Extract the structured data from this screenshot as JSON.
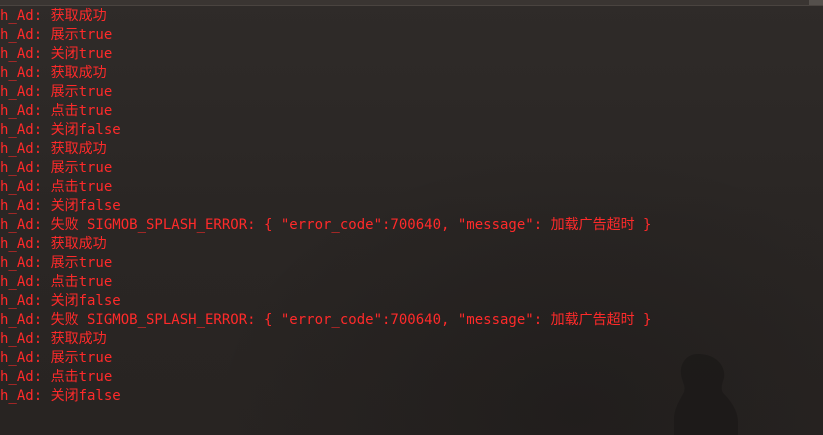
{
  "lines": [
    "h_Ad: 获取成功",
    "h_Ad: 展示true",
    "h_Ad: 关闭true",
    "h_Ad: 获取成功",
    "h_Ad: 展示true",
    "h_Ad: 点击true",
    "h_Ad: 关闭false",
    "h_Ad: 获取成功",
    "h_Ad: 展示true",
    "h_Ad: 点击true",
    "h_Ad: 关闭false",
    "h_Ad: 失败 SIGMOB_SPLASH_ERROR: { \"error_code\":700640, \"message\": 加载广告超时 }",
    "h_Ad: 获取成功",
    "h_Ad: 展示true",
    "h_Ad: 点击true",
    "h_Ad: 关闭false",
    "h_Ad: 失败 SIGMOB_SPLASH_ERROR: { \"error_code\":700640, \"message\": 加载广告超时 }",
    "h_Ad: 获取成功",
    "h_Ad: 展示true",
    "h_Ad: 点击true",
    "h_Ad: 关闭false"
  ],
  "colors": {
    "log_text": "#ff2a2a",
    "background": "#2b2725"
  }
}
